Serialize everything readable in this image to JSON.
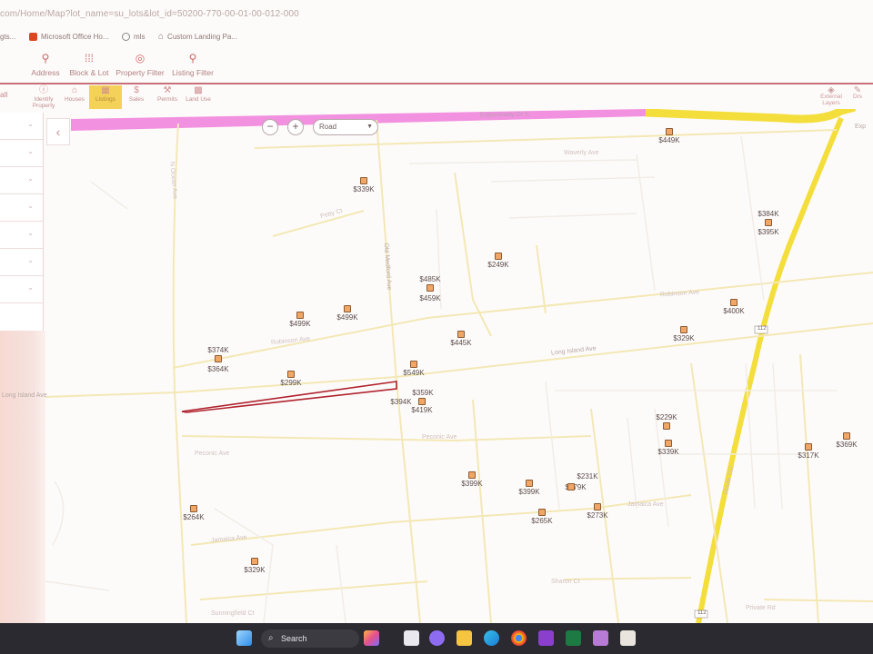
{
  "browser": {
    "url": "com/Home/Map?lot_name=su_lots&lot_id=50200-770-00-01-00-012-000",
    "bookmarks": [
      {
        "label": "gts...",
        "icon": "bookmark-icon"
      },
      {
        "label": "Microsoft Office Ho...",
        "icon": "office-icon"
      },
      {
        "label": "mls",
        "icon": "globe-icon"
      },
      {
        "label": "Custom Landing Pa...",
        "icon": "home-icon"
      }
    ]
  },
  "app_nav": [
    {
      "label": "Address",
      "icon": "location-pin-icon"
    },
    {
      "label": "Block & Lot",
      "icon": "grid-icon"
    },
    {
      "label": "Property Filter",
      "icon": "filter-search-icon"
    },
    {
      "label": "Listing Filter",
      "icon": "location-pin-icon"
    }
  ],
  "map_toolbar": {
    "all_label": "all",
    "items": [
      {
        "label": "Identify Property",
        "icon": "info-icon"
      },
      {
        "label": "Houses",
        "icon": "house-icon"
      },
      {
        "label": "Listings",
        "icon": "listings-icon",
        "active": true
      },
      {
        "label": "Sales",
        "icon": "dollar-icon"
      },
      {
        "label": "Permits",
        "icon": "tools-icon"
      },
      {
        "label": "Land Use",
        "icon": "land-use-icon"
      }
    ],
    "right_items": [
      {
        "label": "External Layers"
      },
      {
        "label": "Drs"
      }
    ]
  },
  "map_controls": {
    "zoom_out": "−",
    "zoom_in": "+",
    "basemap": "Road"
  },
  "streets": {
    "expressway": "Expressway Dr S",
    "waverly": "Waverly Ave",
    "ocean": "N Ocean Ave",
    "petty": "Petty Ct",
    "old_medford": "Old Medford Ave",
    "robinson": "Robinson Ave",
    "long_island": "Long Island Ave",
    "peconic": "Peconic Ave",
    "jamaica": "Jamaica Ave",
    "route": "Route 112",
    "sunningdale": "Sunningfield Ct",
    "private": "Private Rd",
    "shinn": "Sharon Ct",
    "route_shield": "112",
    "exp": "Exp"
  },
  "listings": [
    {
      "price": "$449K"
    },
    {
      "price": "$339K"
    },
    {
      "price": "$384K"
    },
    {
      "price": "$395K"
    },
    {
      "price": "$249K"
    },
    {
      "price": "$485K"
    },
    {
      "price": "$459K"
    },
    {
      "price": "$499K"
    },
    {
      "price": "$499K"
    },
    {
      "price": "$400K"
    },
    {
      "price": "$445K"
    },
    {
      "price": "$329K"
    },
    {
      "price": "$374K"
    },
    {
      "price": "$364K"
    },
    {
      "price": "$299K"
    },
    {
      "price": "$549K"
    },
    {
      "price": "$359K"
    },
    {
      "price": "$394K"
    },
    {
      "price": "$419K"
    },
    {
      "price": "$229K"
    },
    {
      "price": "$339K"
    },
    {
      "price": "$369K"
    },
    {
      "price": "$317K"
    },
    {
      "price": "$231K"
    },
    {
      "price": "$399K"
    },
    {
      "price": "$399K"
    },
    {
      "price": "$379K"
    },
    {
      "price": "$265K"
    },
    {
      "price": "$273K"
    },
    {
      "price": "$264K"
    },
    {
      "price": "$329K"
    }
  ],
  "taskbar": {
    "search_label": "Search"
  },
  "colors": {
    "accent": "#c7707a",
    "expressway": "#f07ed9",
    "highway": "#f4de3c",
    "road": "#f3e8b5",
    "parcel": "#b0222e",
    "marker": "#f0a766"
  }
}
